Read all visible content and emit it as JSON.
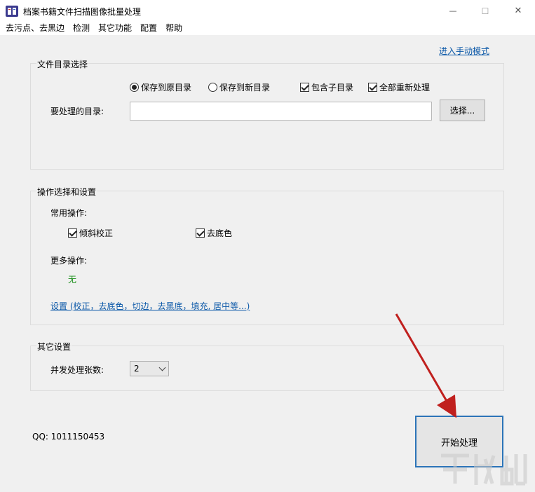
{
  "window": {
    "title": "档案书籍文件扫描图像批量处理",
    "controls": {
      "minimize": "—",
      "maximize": "☐",
      "close": "✕"
    }
  },
  "menu": [
    "去污点、去黑边",
    "检测",
    "其它功能",
    "配置",
    "帮助"
  ],
  "manual_mode_link": "进入手动模式",
  "file_group": {
    "title": "文件目录选择",
    "radio_save_original": "保存到原目录",
    "radio_save_new": "保存到新目录",
    "check_subdirs": "包含子目录",
    "check_reprocess_all": "全部重新处理",
    "dir_label": "要处理的目录:",
    "dir_value": "",
    "browse_button": "选择..."
  },
  "ops_group": {
    "title": "操作选择和设置",
    "common_label": "常用操作:",
    "check_deskew": "倾斜校正",
    "check_remove_bg": "去底色",
    "more_label": "更多操作:",
    "more_value": "无",
    "settings_link": "设置 (校正，去底色，切边，去黑底，填充, 居中等...)"
  },
  "other_group": {
    "title": "其它设置",
    "concurrency_label": "并发处理张数:",
    "concurrency_value": "2"
  },
  "qq_text": "QQ: 1011150453",
  "start_button": "开始处理",
  "colors": {
    "link": "#0b58a8",
    "start_border": "#2c74b8",
    "arrow": "#c0201e",
    "more_value": "#1a8f1a"
  }
}
